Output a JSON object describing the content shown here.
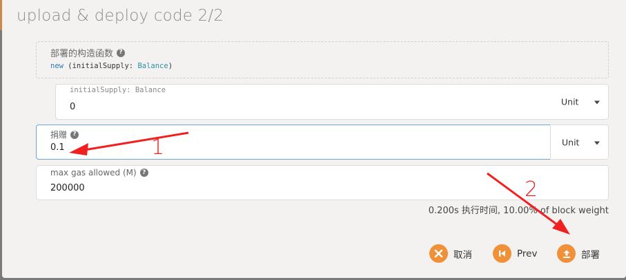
{
  "modal": {
    "title": "upload & deploy code 2/2"
  },
  "constructor": {
    "label": "部署的构造函数",
    "keyword": "new",
    "signature_open": " (initialSupply: ",
    "signature_type": "Balance",
    "signature_close": ")"
  },
  "initial_supply": {
    "label": "initialSupply: Balance",
    "value": "0",
    "unit": "Unit"
  },
  "endowment": {
    "label": "捐赠",
    "value": "0.1",
    "unit": "Unit"
  },
  "max_gas": {
    "label": "max gas allowed (M)",
    "value": "200000"
  },
  "weight_info": "0.200s 执行时间, 10.00% of block weight",
  "buttons": {
    "cancel": "取消",
    "prev": "Prev",
    "deploy": "部署"
  },
  "annotations": {
    "step1": "1",
    "step2": "2"
  },
  "colors": {
    "accent": "#f0913a",
    "annotation": "#f02020",
    "focus_border": "#6aa8d8"
  }
}
